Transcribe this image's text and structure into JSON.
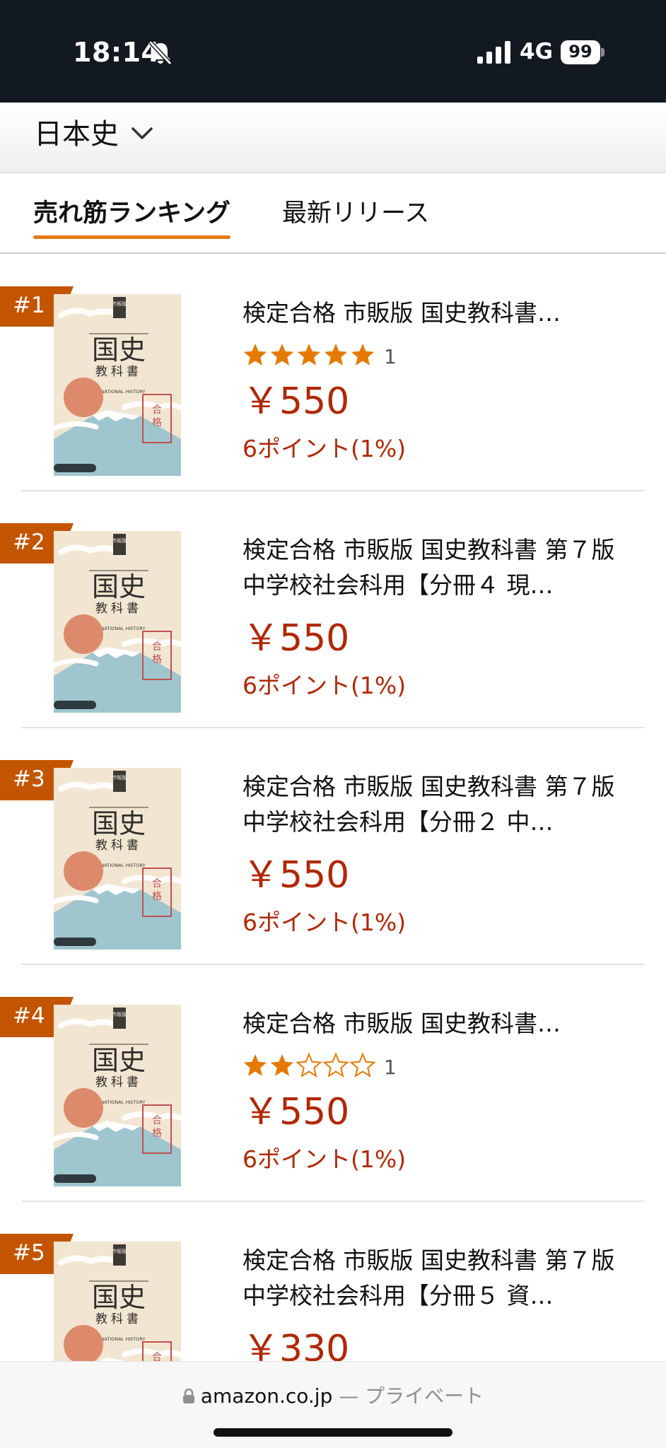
{
  "status_bar": {
    "time": "18:14",
    "network": "4G",
    "battery": "99"
  },
  "category": {
    "title": "日本史"
  },
  "tabs": [
    {
      "label": "売れ筋ランキング",
      "active": true
    },
    {
      "label": "最新リリース",
      "active": false
    }
  ],
  "items": [
    {
      "rank": "#1",
      "title": "検定合格 市販版 国史教科書…",
      "rating": 5,
      "rating_count": "1",
      "price": "￥550",
      "points": "6ポイント(1%)"
    },
    {
      "rank": "#2",
      "title": "検定合格 市販版 国史教科書 第７版　中学校社会科用【分冊４ 現…",
      "price": "￥550",
      "points": "6ポイント(1%)"
    },
    {
      "rank": "#3",
      "title": "検定合格 市販版 国史教科書 第７版　中学校社会科用【分冊２ 中…",
      "price": "￥550",
      "points": "6ポイント(1%)"
    },
    {
      "rank": "#4",
      "title": "検定合格 市販版 国史教科書…",
      "rating": 2,
      "rating_count": "1",
      "price": "￥550",
      "points": "6ポイント(1%)"
    },
    {
      "rank": "#5",
      "title": "検定合格 市販版 国史教科書 第７版　中学校社会科用【分冊５ 資…",
      "price": "￥330",
      "points": ""
    }
  ],
  "cover_text": {
    "title": "国史",
    "subtitle": "教科書",
    "english": "NATIONAL HISTORY",
    "stamp": "合格",
    "edition_tag": "市販版"
  },
  "bottom_bar": {
    "domain": "amazon.co.jp",
    "separator": " — ",
    "privacy": "プライベート"
  },
  "colors": {
    "accent": "#e47911",
    "badge": "#c45500",
    "price": "#b12704",
    "star": "#e67a00"
  }
}
